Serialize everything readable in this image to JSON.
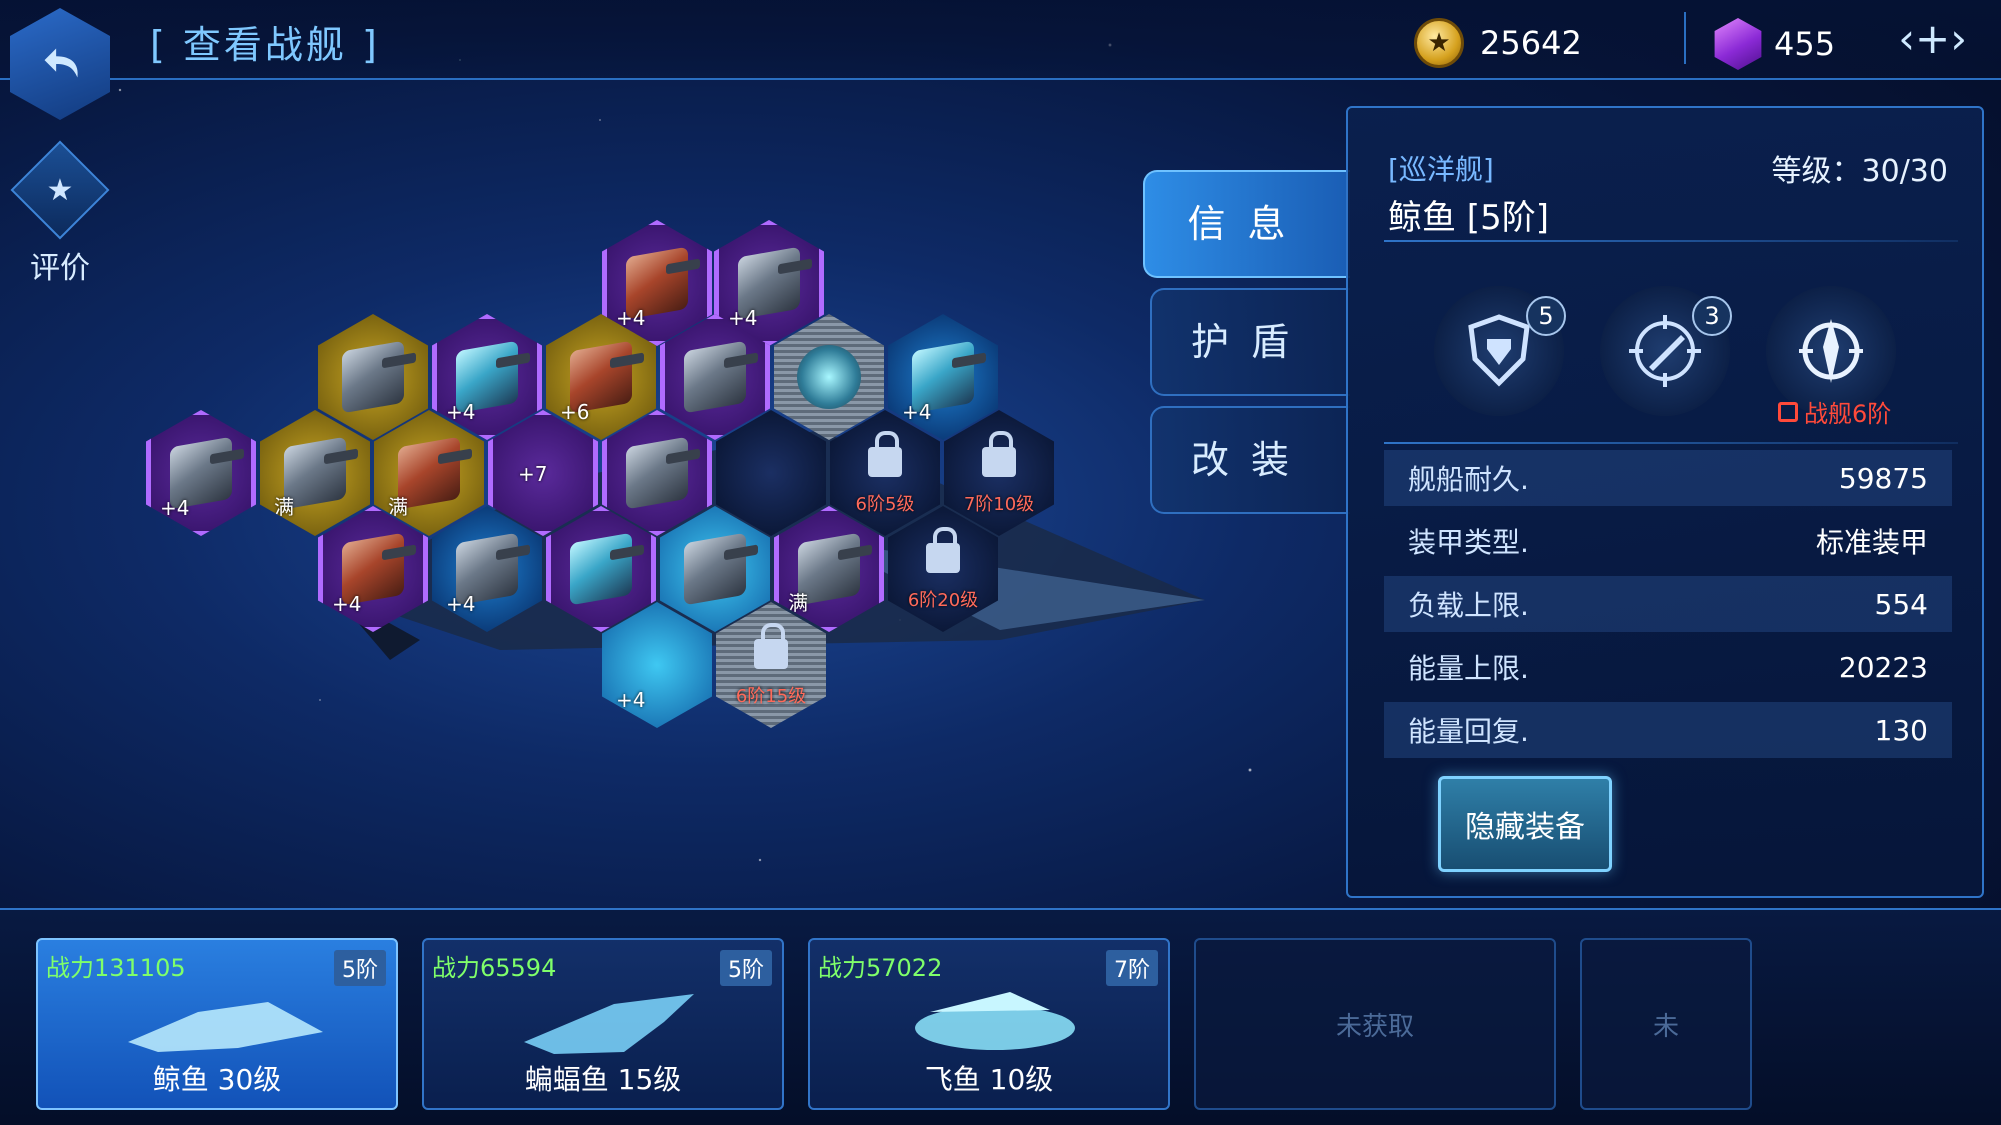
{
  "header": {
    "title": "[ 查看战舰 ]",
    "gold": "25642",
    "gems": "455",
    "add_symbol": "‹+›"
  },
  "rating": {
    "label": "评价"
  },
  "hexes": {
    "h1_badge": "+4",
    "h2_badge": "+4",
    "h3_badge": "+4",
    "h4_badge": "+6",
    "h5_badge": "+4",
    "h6_badge": "满",
    "h7_badge": "满",
    "h8_badge": "+7",
    "h9_badge": "+4",
    "h10_badge": "+4",
    "h11_badge": "+4",
    "h12_badge": "满",
    "h13_badge": "+4",
    "lock1": "6阶5级",
    "lock2": "7阶10级",
    "lock3": "6阶20级",
    "lock4": "6阶15级"
  },
  "tabs": {
    "info": "信息",
    "shield": "护盾",
    "modify": "改装"
  },
  "ship": {
    "class": "[巡洋舰]",
    "level": "等级：30/30",
    "name": "鲸鱼 [5阶]",
    "skill1_level": "5",
    "skill2_level": "3",
    "skill3_lock": "战舰6阶"
  },
  "stats": [
    {
      "label": "舰船耐久.",
      "value": "59875"
    },
    {
      "label": "装甲类型.",
      "value": "标准装甲"
    },
    {
      "label": "负载上限.",
      "value": "554"
    },
    {
      "label": "能量上限.",
      "value": "20223"
    },
    {
      "label": "能量回复.",
      "value": "130"
    }
  ],
  "hide_button": "隐藏装备",
  "ships": [
    {
      "power": "战力131105",
      "tier": "5阶",
      "name": "鲸鱼 30级"
    },
    {
      "power": "战力65594",
      "tier": "5阶",
      "name": "蝙蝠鱼 15级"
    },
    {
      "power": "战力57022",
      "tier": "7阶",
      "name": "飞鱼 10级"
    },
    {
      "empty_label": "未获取"
    },
    {
      "empty_label": "未"
    }
  ],
  "colors": {
    "accent": "#2f74c8",
    "power_text": "#7fff6a",
    "lock_text": "#ff4a3a"
  }
}
